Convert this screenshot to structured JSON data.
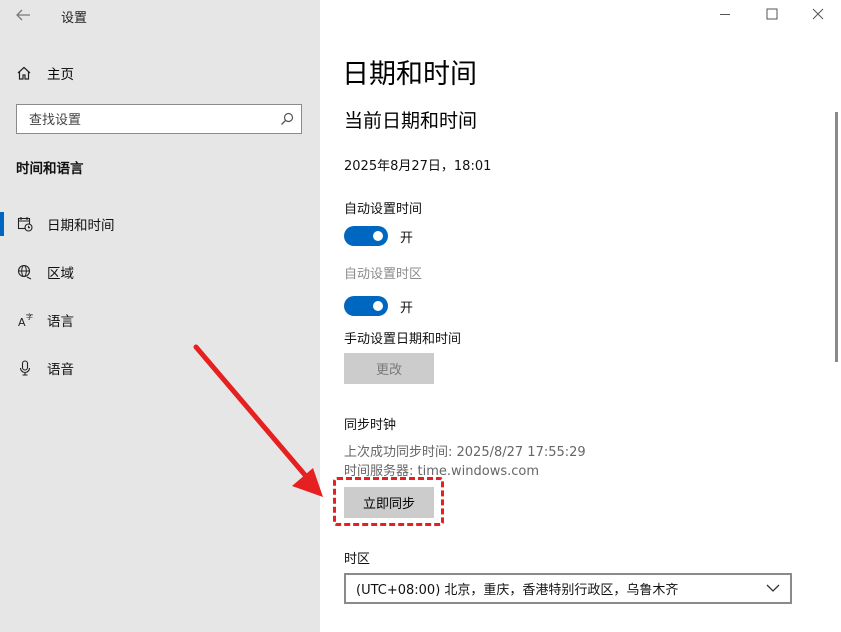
{
  "window": {
    "title": "设置",
    "minimize_label": "—",
    "maximize_label": "☐",
    "close_label": "✕"
  },
  "sidebar": {
    "home_label": "主页",
    "search_placeholder": "查找设置",
    "section_title": "时间和语言",
    "items": [
      {
        "label": "日期和时间",
        "icon": "calendar-clock-icon",
        "active": true
      },
      {
        "label": "区域",
        "icon": "globe-icon",
        "active": false
      },
      {
        "label": "语言",
        "icon": "language-icon",
        "active": false
      },
      {
        "label": "语音",
        "icon": "microphone-icon",
        "active": false
      }
    ]
  },
  "main": {
    "page_title": "日期和时间",
    "current_heading": "当前日期和时间",
    "current_datetime": "2025年8月27日，18:01",
    "auto_time_label": "自动设置时间",
    "auto_time_state": "开",
    "auto_tz_label": "自动设置时区",
    "auto_tz_state": "开",
    "manual_label": "手动设置日期和时间",
    "change_button": "更改",
    "sync_heading": "同步时钟",
    "last_sync": "上次成功同步时间: 2025/8/27 17:55:29",
    "time_server": "时间服务器: time.windows.com",
    "sync_button": "立即同步",
    "timezone_label": "时区",
    "timezone_value": "(UTC+08:00) 北京，重庆，香港特别行政区，乌鲁木齐"
  },
  "colors": {
    "accent": "#0067c0",
    "annotation": "#e62020",
    "sidebar_bg": "#e6e6e6"
  }
}
